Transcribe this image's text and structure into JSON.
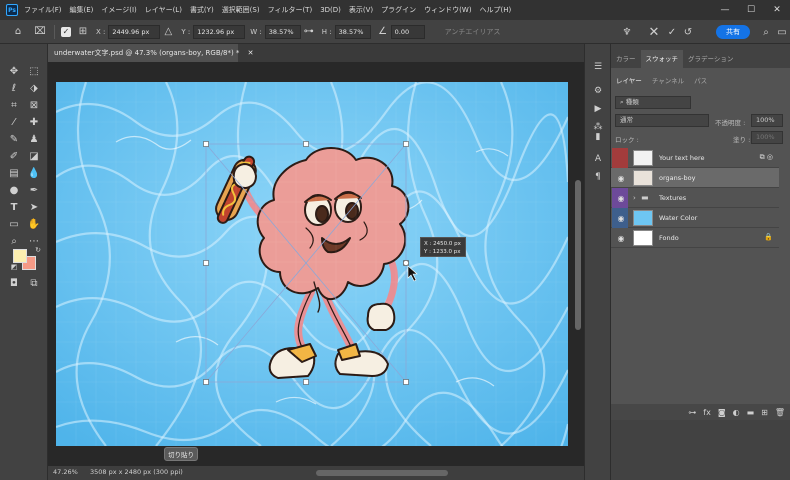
{
  "menu": {
    "items": [
      "ファイル(F)",
      "編集(E)",
      "イメージ(I)",
      "レイヤー(L)",
      "書式(Y)",
      "選択範囲(S)",
      "フィルター(T)",
      "3D(D)",
      "表示(V)",
      "プラグイン",
      "ウィンドウ(W)",
      "ヘルプ(H)"
    ]
  },
  "window": {
    "minimize": "—",
    "maximize": "☐",
    "close": "✕"
  },
  "options": {
    "x_label": "X :",
    "x_value": "2449.96 px",
    "y_label": "Y :",
    "y_value": "1232.96 px",
    "w_label": "W :",
    "w_value": "38.57%",
    "h_label": "H :",
    "h_value": "38.57%",
    "angle_value": "0.00",
    "antialias_label": "アンチエイリアス",
    "share_label": "共有"
  },
  "document": {
    "tab_title": "underwater文字.psd @ 47.3% (organs-boy, RGB/8*) *",
    "tab_close": "✕"
  },
  "colors": {
    "foreground": "#fcefb0",
    "background": "#f59a86",
    "accent": "#1473e6"
  },
  "readout": {
    "x": "X :   2450.0 px",
    "y": "Y :   1233.0 px"
  },
  "cut_button": "切り貼り",
  "status": {
    "zoom": "47.26%",
    "info": "3508 px x 2480 px (300 ppi)"
  },
  "panels": {
    "top_tabs": [
      "カラー",
      "スウォッチ",
      "グラデーション"
    ],
    "layer_tabs": [
      "レイヤー",
      "チャンネル",
      "パス"
    ],
    "search_placeholder": "種類",
    "blend_mode": "通常",
    "opacity_label": "不透明度 :",
    "opacity_value": "100%",
    "lock_label": "ロック :",
    "fill_label": "塗り :",
    "fill_value": "100%",
    "layers": [
      {
        "name": "Your text here"
      },
      {
        "name": "organs-boy"
      },
      {
        "name": "Textures"
      },
      {
        "name": "Water Color"
      },
      {
        "name": "Fondo"
      }
    ]
  }
}
